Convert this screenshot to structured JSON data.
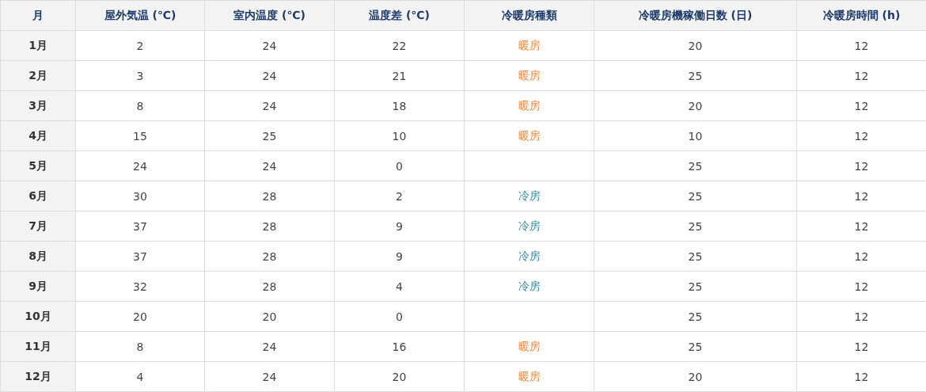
{
  "table": {
    "columns": [
      "月",
      "屋外気温 (℃)",
      "室内温度 (℃)",
      "温度差 (℃)",
      "冷暖房種類",
      "冷暖房機稼働日数 (日)",
      "冷暖房時間 (h)"
    ],
    "rows": [
      {
        "month": "1月",
        "outdoor": "2",
        "indoor": "24",
        "diff": "22",
        "type": {
          "text": "暖房",
          "color": "#f0883c"
        },
        "days": "20",
        "hours": "12"
      },
      {
        "month": "2月",
        "outdoor": "3",
        "indoor": "24",
        "diff": "21",
        "type": {
          "text": "暖房",
          "color": "#f0883c"
        },
        "days": "25",
        "hours": "12"
      },
      {
        "month": "3月",
        "outdoor": "8",
        "indoor": "24",
        "diff": "18",
        "type": {
          "text": "暖房",
          "color": "#f0883c"
        },
        "days": "20",
        "hours": "12"
      },
      {
        "month": "4月",
        "outdoor": "15",
        "indoor": "25",
        "diff": "10",
        "type": {
          "text": "暖房",
          "color": "#f0883c"
        },
        "days": "10",
        "hours": "12"
      },
      {
        "month": "5月",
        "outdoor": "24",
        "indoor": "24",
        "diff": "0",
        "days": "25",
        "hours": "12"
      },
      {
        "month": "6月",
        "outdoor": "30",
        "indoor": "28",
        "diff": "2",
        "type": {
          "text": "冷房",
          "color": "#2f8a9f"
        },
        "days": "25",
        "hours": "12"
      },
      {
        "month": "7月",
        "outdoor": "37",
        "indoor": "28",
        "diff": "9",
        "type": {
          "text": "冷房",
          "color": "#2f8a9f"
        },
        "days": "25",
        "hours": "12"
      },
      {
        "month": "8月",
        "outdoor": "37",
        "indoor": "28",
        "diff": "9",
        "type": {
          "text": "冷房",
          "color": "#2f8a9f"
        },
        "days": "25",
        "hours": "12"
      },
      {
        "month": "9月",
        "outdoor": "32",
        "indoor": "28",
        "diff": "4",
        "type": {
          "text": "冷房",
          "color": "#2f8a9f"
        },
        "days": "25",
        "hours": "12"
      },
      {
        "month": "10月",
        "outdoor": "20",
        "indoor": "20",
        "diff": "0",
        "days": "25",
        "hours": "12"
      },
      {
        "month": "11月",
        "outdoor": "8",
        "indoor": "24",
        "diff": "16",
        "type": {
          "text": "暖房",
          "color": "#f0883c"
        },
        "days": "25",
        "hours": "12"
      },
      {
        "month": "12月",
        "outdoor": "4",
        "indoor": "24",
        "diff": "20",
        "type": {
          "text": "暖房",
          "color": "#f0883c"
        },
        "days": "20",
        "hours": "12"
      }
    ]
  }
}
